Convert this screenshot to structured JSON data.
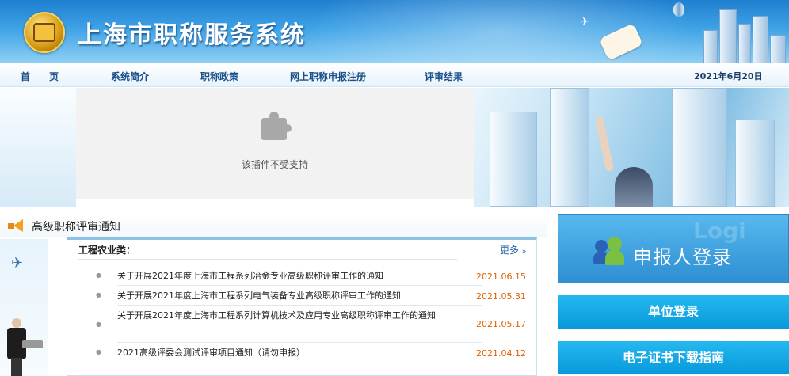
{
  "header": {
    "site_title": "上海市职称服务系统",
    "logo": "shanghai-emblem-logo"
  },
  "nav": {
    "items": [
      {
        "label": "首　　页"
      },
      {
        "label": "系统简介"
      },
      {
        "label": "职称政策"
      },
      {
        "label": "网上职称申报注册"
      },
      {
        "label": "评审结果"
      }
    ],
    "date": "2021年6月20日"
  },
  "plugin": {
    "message": "该插件不受支持",
    "icon": "puzzle-piece-icon"
  },
  "notice": {
    "section_title": "高级职称评审通知",
    "category": "工程农业类：",
    "more_label": "更多",
    "items": [
      {
        "title": "关于开展2021年度上海市工程系列冶金专业高级职称评审工作的通知",
        "date": "2021.06.15"
      },
      {
        "title": "关于开展2021年度上海市工程系列电气装备专业高级职称评审工作的通知",
        "date": "2021.05.31"
      },
      {
        "title": "关于开展2021年度上海市工程系列计算机技术及应用专业高级职称评审工作的通知",
        "date": "2021.05.17"
      },
      {
        "title": "2021高级评委会测试评审项目通知（请勿申报）",
        "date": "2021.04.12"
      }
    ]
  },
  "sidebar": {
    "applicant_login_label": "申报人登录",
    "login_ghost": "Logi",
    "unit_login_label": "单位登录",
    "certificate_guide_label": "电子证书下载指南"
  },
  "colors": {
    "header_blue": "#1f7fd0",
    "nav_text": "#1a4f8a",
    "date_orange": "#e15f00",
    "button_blue": "#0799db"
  }
}
